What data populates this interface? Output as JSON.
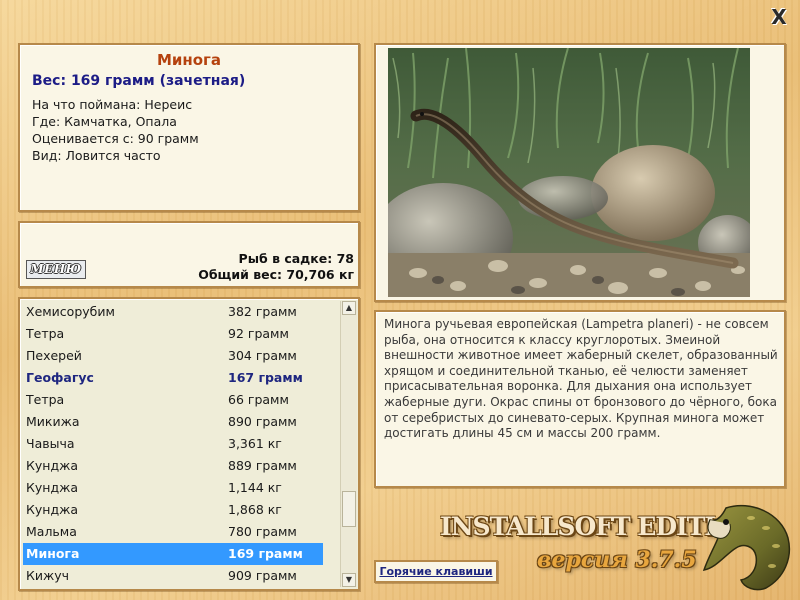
{
  "window": {
    "close_icon": "close-icon",
    "close_glyph": "X"
  },
  "fish": {
    "name": "Минога",
    "weight": "Вес: 169 грамм (зачетная)",
    "bait": "На что поймана: Нереис",
    "location": "Где: Камчатка, Опала",
    "rated_from": "Оценивается с: 90 грамм",
    "frequency": "Вид: Ловится часто"
  },
  "stats": {
    "menu_label": "МЕНЮ",
    "fish_in_keepnet": "Рыб в садке: 78",
    "total_weight": "Общий вес: 70,706 кг"
  },
  "catch_list": [
    {
      "name": "Хемисорубим",
      "weight": "382 грамм",
      "style": "normal"
    },
    {
      "name": "Тетра",
      "weight": "92 грамм",
      "style": "normal"
    },
    {
      "name": "Пехерей",
      "weight": "304 грамм",
      "style": "normal"
    },
    {
      "name": "Геофагус",
      "weight": "167 грамм",
      "style": "highlight"
    },
    {
      "name": "Тетра",
      "weight": "66 грамм",
      "style": "normal"
    },
    {
      "name": "Микижа",
      "weight": "890 грамм",
      "style": "normal"
    },
    {
      "name": "Чавыча",
      "weight": "3,361 кг",
      "style": "normal"
    },
    {
      "name": "Кунджа",
      "weight": "889 грамм",
      "style": "normal"
    },
    {
      "name": "Кунджа",
      "weight": "1,144 кг",
      "style": "normal"
    },
    {
      "name": "Кунджа",
      "weight": "1,868 кг",
      "style": "normal"
    },
    {
      "name": "Мальма",
      "weight": "780 грамм",
      "style": "normal"
    },
    {
      "name": "Минога",
      "weight": "169 грамм",
      "style": "selected"
    },
    {
      "name": "Кижуч",
      "weight": "909 грамм",
      "style": "normal"
    }
  ],
  "scrollbar": {
    "up_glyph": "▲",
    "down_glyph": "▼"
  },
  "description": "Минога ручьевая европейская (Lampetra planeri) - не совсем рыба, она относится к классу круглоротых. Змеиной внешности животное имеет жаберный скелет, образованный хрящом и соединительной тканью, её челюсти заменяет присасывательная воронка. Для дыхания она использует жаберные дуги. Окрас спины от бронзового до чёрного, бока от серебристых до синевато-серых. Крупная минога может достигать длины 45 см и массы 200 грамм.",
  "hotkeys_label": "Горячие клавиши",
  "brand": {
    "edition": "INSTALLSOFT EDITION",
    "version": "версия 3.7.5"
  },
  "colors": {
    "background": "#eec785",
    "panel": "#faf6e6",
    "panel_border": "#b6894a",
    "fish_name": "#b5420e",
    "weight_text": "#1c1c86",
    "selection": "#3399ff",
    "highlight_text": "#1e2680"
  }
}
